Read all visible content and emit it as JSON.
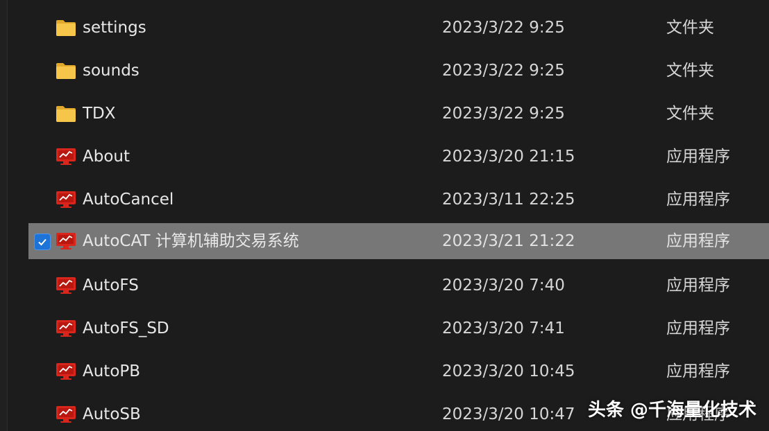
{
  "files": [
    {
      "name": "settings",
      "modified": "2023/3/22 9:25",
      "type": "文件夹",
      "icon": "folder-icon",
      "selected": false
    },
    {
      "name": "sounds",
      "modified": "2023/3/22 9:25",
      "type": "文件夹",
      "icon": "folder-icon",
      "selected": false
    },
    {
      "name": "TDX",
      "modified": "2023/3/22 9:25",
      "type": "文件夹",
      "icon": "folder-icon",
      "selected": false
    },
    {
      "name": "About",
      "modified": "2023/3/20 21:15",
      "type": "应用程序",
      "icon": "app-chart-icon",
      "selected": false
    },
    {
      "name": "AutoCancel",
      "modified": "2023/3/11 22:25",
      "type": "应用程序",
      "icon": "app-chart-icon",
      "selected": false
    },
    {
      "name": "AutoCAT 计算机辅助交易系统",
      "modified": "2023/3/21 21:22",
      "type": "应用程序",
      "icon": "app-chart-icon",
      "selected": true
    },
    {
      "name": "AutoFS",
      "modified": "2023/3/20 7:40",
      "type": "应用程序",
      "icon": "app-chart-icon",
      "selected": false
    },
    {
      "name": "AutoFS_SD",
      "modified": "2023/3/20 7:41",
      "type": "应用程序",
      "icon": "app-chart-icon",
      "selected": false
    },
    {
      "name": "AutoPB",
      "modified": "2023/3/20 10:45",
      "type": "应用程序",
      "icon": "app-chart-icon",
      "selected": false
    },
    {
      "name": "AutoSB",
      "modified": "2023/3/20 10:47",
      "type": "应用程序",
      "icon": "app-chart-icon",
      "selected": false
    }
  ],
  "watermark": "头条 @千海量化技术",
  "colors": {
    "background": "#1c1c1c",
    "selected_row": "#777777",
    "checkbox": "#1e73d6",
    "folder": "#f5c64a",
    "app_icon": "#d8261c"
  }
}
